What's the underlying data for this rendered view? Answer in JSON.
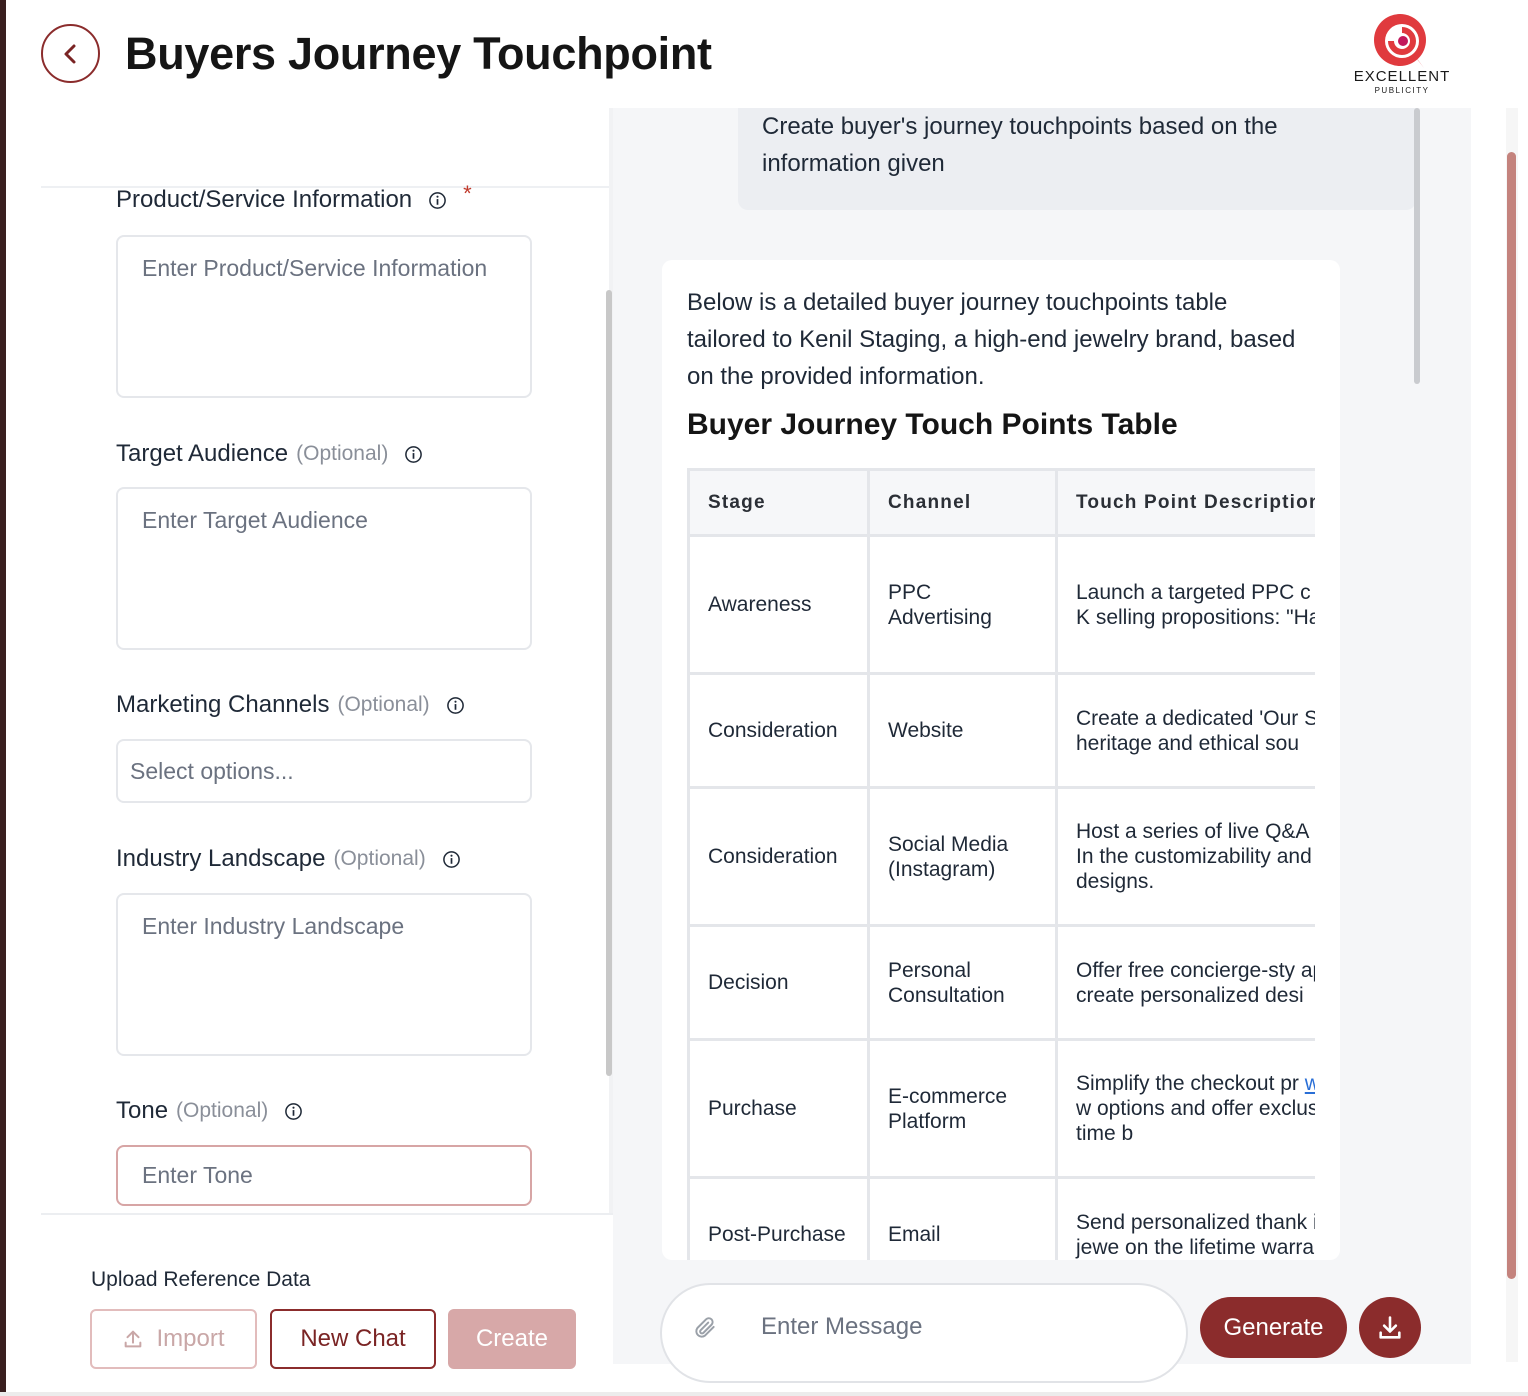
{
  "header": {
    "title": "Buyers Journey Touchpoint",
    "logo_text": "EXCELLENT",
    "logo_subtext": "PUBLICITY",
    "logo_mark": "®"
  },
  "form": {
    "product": {
      "label": "Product/Service Information",
      "required_mark": "*",
      "placeholder": "Enter Product/Service Information"
    },
    "audience": {
      "label": "Target Audience",
      "optional": "(Optional)",
      "placeholder": "Enter Target Audience"
    },
    "channels": {
      "label": "Marketing Channels",
      "optional": "(Optional)",
      "placeholder": "Select options..."
    },
    "industry": {
      "label": "Industry Landscape",
      "optional": "(Optional)",
      "placeholder": "Enter Industry Landscape"
    },
    "tone": {
      "label": "Tone",
      "optional": "(Optional)",
      "placeholder": "Enter Tone"
    },
    "upload_label": "Upload Reference Data",
    "import_label": "Import",
    "new_chat_label": "New Chat",
    "create_label": "Create"
  },
  "chat": {
    "user_message": "Create buyer's journey touchpoints based on the information given",
    "ai_intro": "Below is a detailed buyer journey touchpoints table tailored to Kenil Staging, a high-end jewelry brand, based on the provided information.",
    "ai_heading": "Buyer Journey Touch Points Table",
    "table": {
      "headers": [
        "Stage",
        "Channel",
        "Touch Point Description"
      ],
      "rows": [
        {
          "stage": "Awareness",
          "channel": "PPC Advertising",
          "desc": "Launch a targeted PPC c stunning ads featuring K selling propositions: \"Ha and \"Ethical Luxury.\""
        },
        {
          "stage": "Consideration",
          "channel": "Website",
          "desc": "Create a dedicated 'Our Staging website detailin heritage and ethical sou"
        },
        {
          "stage": "Consideration",
          "channel": "Social Media (Instagram)",
          "desc": "Host a series of live Q&A on showcases through In the customizability and h innovation of designs."
        },
        {
          "stage": "Decision",
          "channel": "Personal Consultation",
          "desc": "Offer free concierge-sty appointments, either virt create personalized desi"
        },
        {
          "stage": "Purchase",
          "channel": "E-commerce Platform",
          "desc_before": "Simplify the checkout pr",
          "link": "www.kenilstaging.com",
          "desc_after": "w options and offer exclus discounts for first-time b"
        },
        {
          "stage": "Post-Purchase",
          "channel": "Email",
          "desc": "Send personalized thank instructions for the jewe on the lifetime warranty"
        }
      ]
    },
    "composer_placeholder": "Enter Message",
    "generate_label": "Generate"
  },
  "colors": {
    "brand": "#8b2c2c",
    "brand_light": "#d7a8a8",
    "panel_bg": "#f5f6f8"
  },
  "icons": [
    "back-chevron-icon",
    "info-icon",
    "upload-icon",
    "paperclip-icon",
    "download-icon",
    "logo-swirl-icon"
  ]
}
